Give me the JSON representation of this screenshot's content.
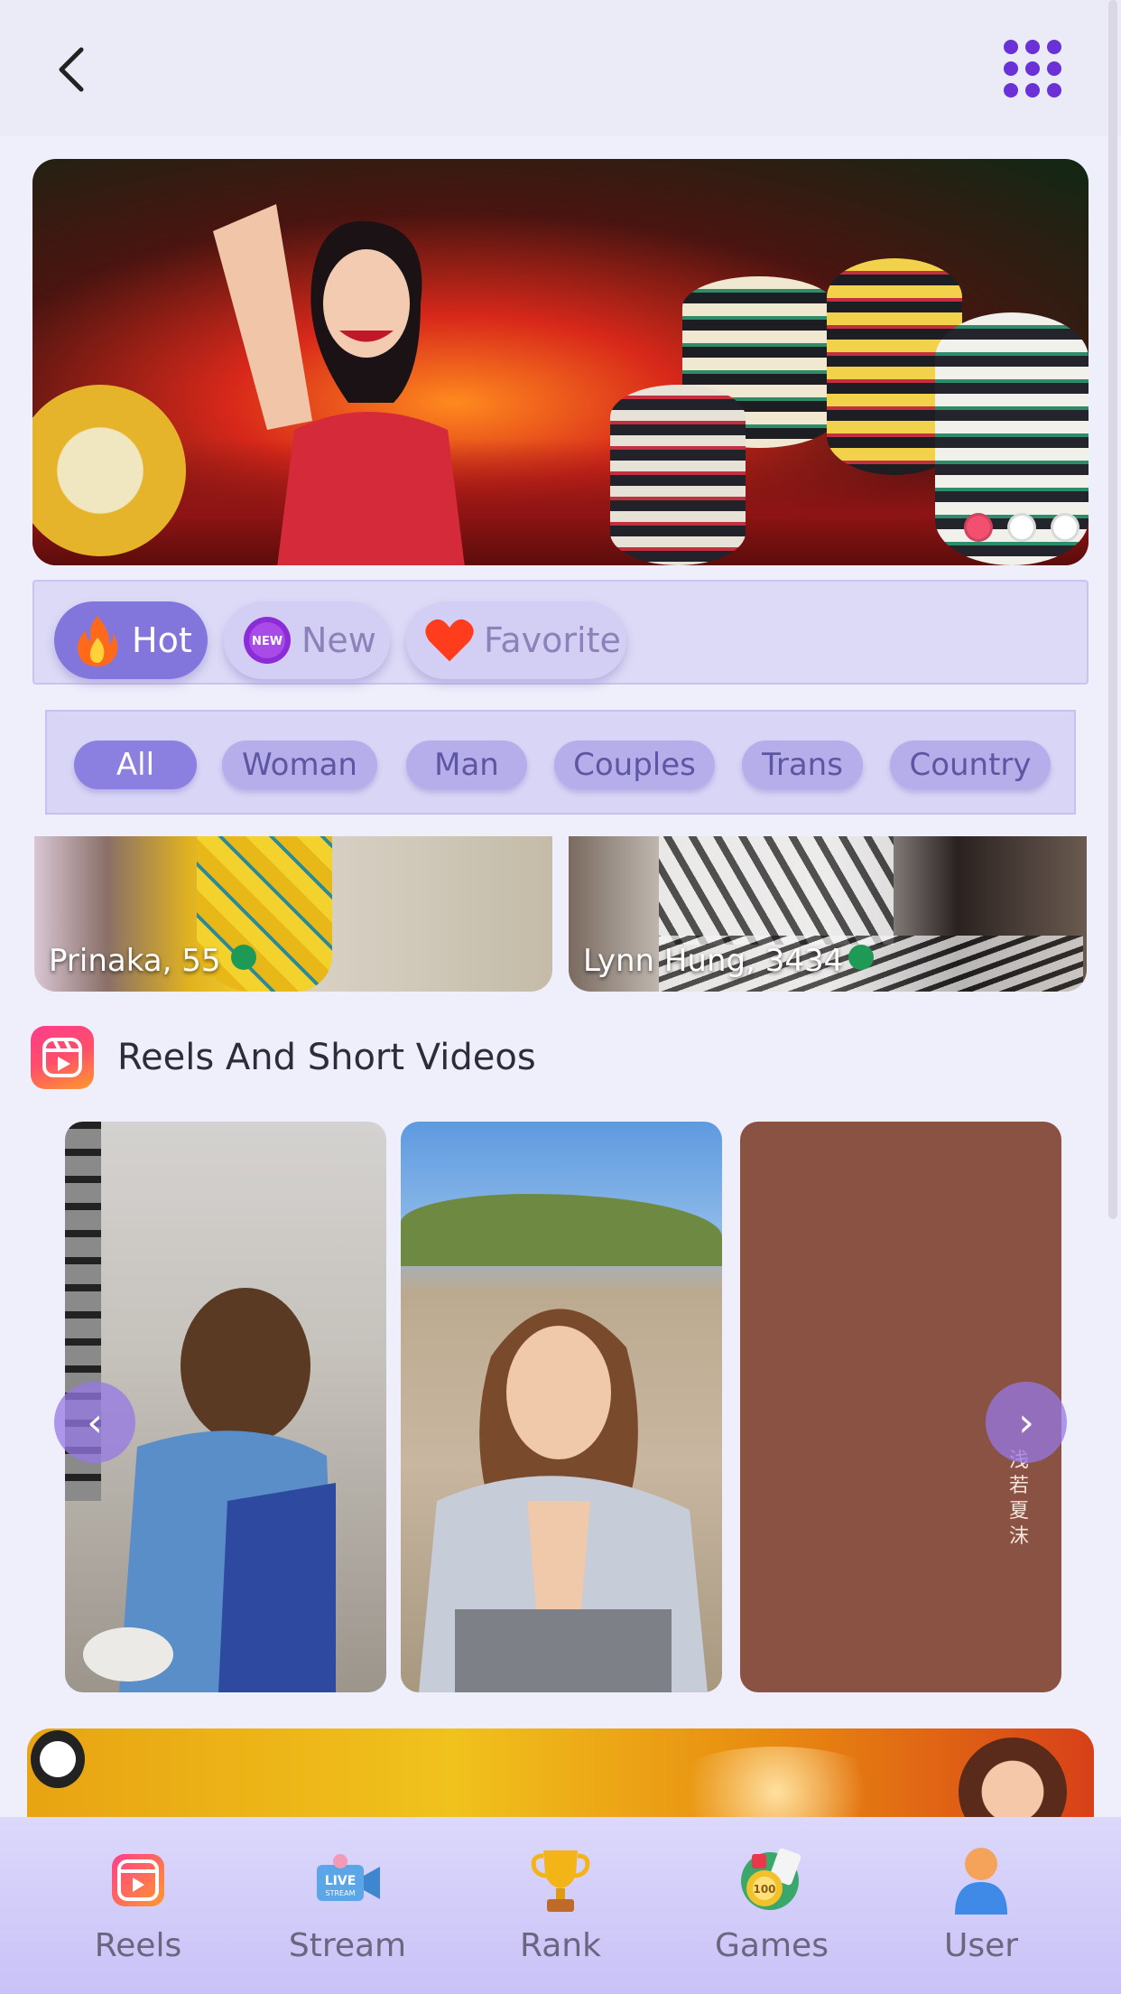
{
  "header": {
    "back_icon": "chevron-left-icon",
    "menu_icon": "grid-dots-icon",
    "accent": "#6a32d6"
  },
  "banner": {
    "slides": 3,
    "active_slide": 0,
    "dot_colors": [
      "#f2506e",
      "#ffffff",
      "#ffffff"
    ]
  },
  "tabs": [
    {
      "label": "Hot",
      "icon": "flame-icon",
      "active": true
    },
    {
      "label": "New",
      "icon": "new-badge-icon",
      "active": false
    },
    {
      "label": "Favorite",
      "icon": "heart-icon",
      "active": false
    }
  ],
  "filters": [
    {
      "label": "All",
      "active": true
    },
    {
      "label": "Woman",
      "active": false
    },
    {
      "label": "Man",
      "active": false
    },
    {
      "label": "Couples",
      "active": false
    },
    {
      "label": "Trans",
      "active": false
    },
    {
      "label": "Country",
      "active": false
    }
  ],
  "profiles": [
    {
      "name": "Prinaka, 55",
      "online": true
    },
    {
      "name": "Lynn Hung, 3434",
      "online": true
    }
  ],
  "reels": {
    "title": "Reels And Short Videos",
    "icon": "reels-icon",
    "card3_caption": "浅若夏沫",
    "prev_label": "‹",
    "next_label": "›"
  },
  "bottom_nav": [
    {
      "label": "Reels",
      "icon": "reels-icon"
    },
    {
      "label": "Stream",
      "icon": "live-stream-icon"
    },
    {
      "label": "Rank",
      "icon": "trophy-icon"
    },
    {
      "label": "Games",
      "icon": "poker-chip-icon"
    },
    {
      "label": "User",
      "icon": "user-icon"
    }
  ]
}
